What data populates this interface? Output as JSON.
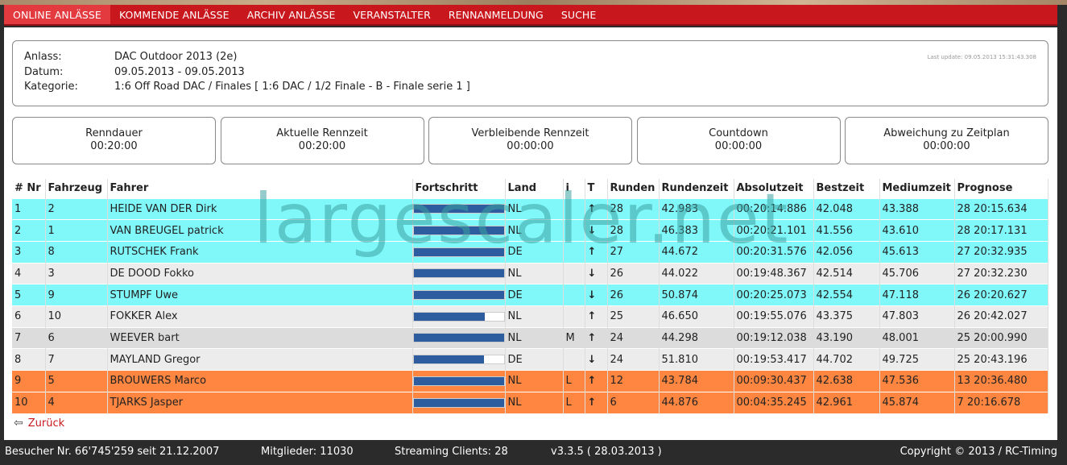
{
  "nav": {
    "items": [
      "ONLINE ANLÄSSE",
      "KOMMENDE ANLÄSSE",
      "ARCHIV ANLÄSSE",
      "VERANSTALTER",
      "RENNANMELDUNG",
      "SUCHE"
    ]
  },
  "info": {
    "anlass_label": "Anlass:",
    "anlass_value": "DAC Outdoor 2013 (2e)",
    "datum_label": "Datum:",
    "datum_value": "09.05.2013 - 09.05.2013",
    "kategorie_label": "Kategorie:",
    "kategorie_value": "1:6 Off Road DAC / Finales [ 1:6 DAC / 1/2 Finale - B - Finale serie 1 ]",
    "last_update": "Last update: 09.05.2013 15:31:43.308"
  },
  "timers": [
    {
      "label": "Renndauer",
      "value": "00:20:00"
    },
    {
      "label": "Aktuelle Rennzeit",
      "value": "00:20:00"
    },
    {
      "label": "Verbleibende Rennzeit",
      "value": "00:00:00"
    },
    {
      "label": "Countdown",
      "value": "00:00:00"
    },
    {
      "label": "Abweichung zu Zeitplan",
      "value": "00:00:00"
    }
  ],
  "table": {
    "headers": [
      "# Nr",
      "Fahrzeug",
      "Fahrer",
      "Fortschritt",
      "Land",
      "i",
      "T",
      "Runden",
      "Rundenzeit",
      "Absolutzeit",
      "Bestzeit",
      "Mediumzeit",
      "Prognose"
    ],
    "rows": [
      {
        "nr": "1",
        "fahrzeug": "2",
        "fahrer": "HEIDE VAN DER Dirk",
        "progress": 1.0,
        "land": "NL",
        "i": "",
        "trend": "up",
        "runden": "28",
        "rundenzeit": "42.983",
        "absolutzeit": "00:20:14.886",
        "bestzeit": "42.048",
        "mediumzeit": "43.388",
        "prognose": "28 20:15.634",
        "color": "cyan"
      },
      {
        "nr": "2",
        "fahrzeug": "1",
        "fahrer": "VAN BREUGEL patrick",
        "progress": 1.0,
        "land": "NL",
        "i": "",
        "trend": "down",
        "runden": "28",
        "rundenzeit": "46.383",
        "absolutzeit": "00:20:21.101",
        "bestzeit": "41.556",
        "mediumzeit": "43.610",
        "prognose": "28 20:17.131",
        "color": "cyan"
      },
      {
        "nr": "3",
        "fahrzeug": "8",
        "fahrer": "RUTSCHEK Frank",
        "progress": 1.0,
        "land": "DE",
        "i": "",
        "trend": "up",
        "runden": "27",
        "rundenzeit": "44.672",
        "absolutzeit": "00:20:31.576",
        "bestzeit": "42.056",
        "mediumzeit": "45.613",
        "prognose": "27 20:32.935",
        "color": "cyan"
      },
      {
        "nr": "4",
        "fahrzeug": "3",
        "fahrer": "DE DOOD Fokko",
        "progress": 1.0,
        "land": "NL",
        "i": "",
        "trend": "down",
        "runden": "26",
        "rundenzeit": "44.022",
        "absolutzeit": "00:19:48.367",
        "bestzeit": "42.514",
        "mediumzeit": "45.706",
        "prognose": "27 20:32.230",
        "color": "grey"
      },
      {
        "nr": "5",
        "fahrzeug": "9",
        "fahrer": "STUMPF Uwe",
        "progress": 1.0,
        "land": "DE",
        "i": "",
        "trend": "down",
        "runden": "26",
        "rundenzeit": "50.874",
        "absolutzeit": "00:20:25.073",
        "bestzeit": "42.554",
        "mediumzeit": "47.118",
        "prognose": "26 20:20.627",
        "color": "cyan"
      },
      {
        "nr": "6",
        "fahrzeug": "10",
        "fahrer": "FOKKER Alex",
        "progress": 0.79,
        "land": "NL",
        "i": "",
        "trend": "up",
        "runden": "25",
        "rundenzeit": "46.650",
        "absolutzeit": "00:19:55.076",
        "bestzeit": "43.375",
        "mediumzeit": "47.803",
        "prognose": "26 20:42.027",
        "color": "grey"
      },
      {
        "nr": "7",
        "fahrzeug": "6",
        "fahrer": "WEEVER bart",
        "progress": 1.0,
        "land": "NL",
        "i": "M",
        "trend": "up",
        "runden": "24",
        "rundenzeit": "44.298",
        "absolutzeit": "00:19:12.038",
        "bestzeit": "43.190",
        "mediumzeit": "48.001",
        "prognose": "25 20:00.990",
        "color": "grey2"
      },
      {
        "nr": "8",
        "fahrzeug": "7",
        "fahrer": "MAYLAND Gregor",
        "progress": 0.78,
        "land": "DE",
        "i": "",
        "trend": "down",
        "runden": "24",
        "rundenzeit": "51.810",
        "absolutzeit": "00:19:53.417",
        "bestzeit": "44.702",
        "mediumzeit": "49.725",
        "prognose": "25 20:43.196",
        "color": "grey"
      },
      {
        "nr": "9",
        "fahrzeug": "5",
        "fahrer": "BROUWERS Marco",
        "progress": 1.0,
        "land": "NL",
        "i": "L",
        "trend": "up",
        "runden": "12",
        "rundenzeit": "43.784",
        "absolutzeit": "00:09:30.437",
        "bestzeit": "42.638",
        "mediumzeit": "47.536",
        "prognose": "13 20:36.480",
        "color": "orange"
      },
      {
        "nr": "10",
        "fahrzeug": "4",
        "fahrer": "TJARKS Jasper",
        "progress": 1.0,
        "land": "NL",
        "i": "L",
        "trend": "up",
        "runden": "6",
        "rundenzeit": "44.876",
        "absolutzeit": "00:04:35.245",
        "bestzeit": "42.961",
        "mediumzeit": "45.874",
        "prognose": "7 20:16.678",
        "color": "orange"
      }
    ]
  },
  "watermark": "largescaler.net",
  "back_label": "Zurück",
  "footer": {
    "visitors": "Besucher Nr. 66'745'259 seit 21.12.2007",
    "members": "Mitglieder: 11030",
    "streaming": "Streaming Clients: 28",
    "version": "v3.3.5 ( 28.03.2013 )",
    "copyright": "Copyright © 2013 / RC-Timing"
  },
  "colors": {
    "nav": "#c8181e",
    "cyan_row": "#80f8fa",
    "orange_row": "#ff8640",
    "progress_fill": "#2e5d9f"
  }
}
